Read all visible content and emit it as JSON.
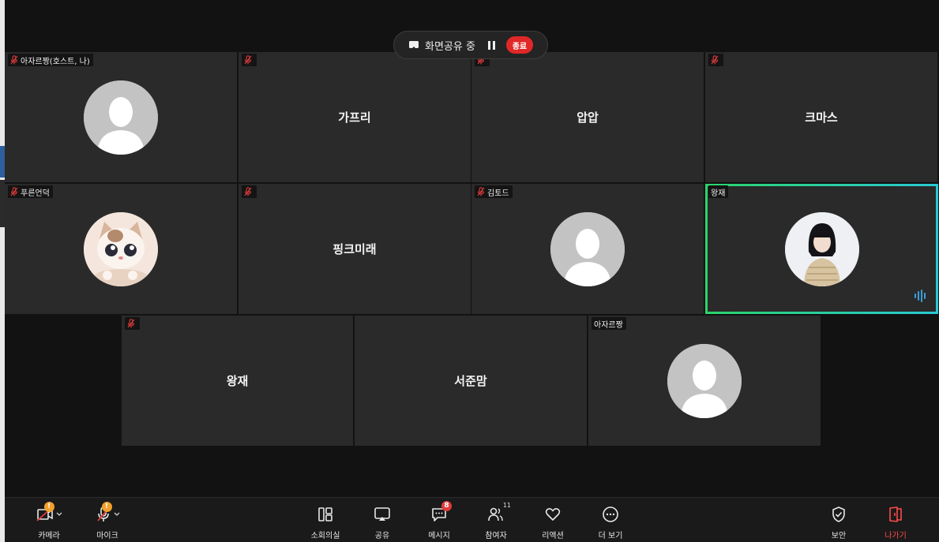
{
  "share_bar": {
    "label": "화면공유 중",
    "stop_label": "종료"
  },
  "participants": [
    {
      "name": "아자르짱(호스트, 나)",
      "muted": true,
      "display": "avatar-default"
    },
    {
      "name": "가프리",
      "muted": true,
      "display": "name"
    },
    {
      "name": "압압",
      "muted": true,
      "display": "name"
    },
    {
      "name": "크마스",
      "muted": true,
      "display": "name"
    },
    {
      "name": "푸른언덕",
      "muted": true,
      "display": "avatar-cat"
    },
    {
      "name": "핑크미래",
      "muted": true,
      "display": "name"
    },
    {
      "name": "김토드",
      "muted": true,
      "display": "avatar-default"
    },
    {
      "name": "왕재",
      "muted": false,
      "display": "avatar-doll",
      "speaking": true
    },
    {
      "name": "왕재",
      "muted": true,
      "display": "name"
    },
    {
      "name": "서준맘",
      "muted": false,
      "display": "name"
    },
    {
      "name": "아자르짱",
      "muted": false,
      "display": "avatar-default"
    }
  ],
  "toolbar": {
    "camera": {
      "label": "카메라",
      "icon": "camera-off-icon",
      "badge": "!"
    },
    "mic": {
      "label": "마이크",
      "icon": "mic-off-icon",
      "badge": "!"
    },
    "breakout": {
      "label": "소회의실",
      "icon": "breakout-rooms-icon"
    },
    "share": {
      "label": "공유",
      "icon": "share-screen-icon"
    },
    "chat": {
      "label": "메시지",
      "icon": "chat-icon",
      "badge": "8"
    },
    "participants": {
      "label": "참여자",
      "icon": "participants-icon",
      "count": "11"
    },
    "reactions": {
      "label": "리액션",
      "icon": "heart-icon"
    },
    "more": {
      "label": "더 보기",
      "icon": "more-icon"
    },
    "security": {
      "label": "보안",
      "icon": "shield-icon"
    },
    "leave": {
      "label": "나가기",
      "icon": "leave-icon"
    }
  },
  "colors": {
    "muted_mic": "#e23b3b",
    "active_speaker_border_start": "#2bd46b",
    "active_speaker_border_end": "#29c9d4",
    "leave": "#ff4a4a"
  }
}
